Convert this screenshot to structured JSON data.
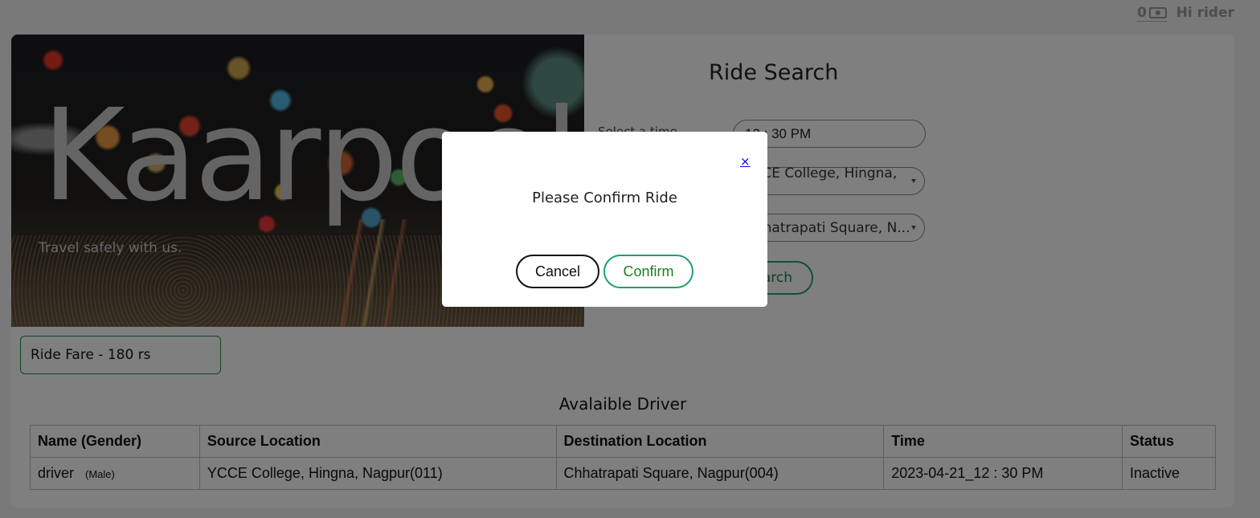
{
  "header": {
    "wallet_amount": "0",
    "wallet_icon": "money-icon",
    "greeting": "Hi rider"
  },
  "hero": {
    "brand": "Kaarpool",
    "tagline": "Travel safely with us."
  },
  "search": {
    "title": "Ride Search",
    "time_label": "Select a time",
    "time_value": "12 : 30 PM",
    "source_value": "YCCE College, Hingna, ...",
    "destination_value": "Chhatrapati Square, N...",
    "search_label": "Search"
  },
  "fare": {
    "text": "Ride Fare - 180 rs"
  },
  "drivers": {
    "title": "Avalaible Driver",
    "columns": [
      "Name (Gender)",
      "Source Location",
      "Destination Location",
      "Time",
      "Status"
    ],
    "rows": [
      {
        "name": "driver",
        "gender": "(Male)",
        "source": "YCCE College, Hingna, Nagpur(011)",
        "destination": "Chhatrapati Square, Nagpur(004)",
        "time": "2023-04-21_12 : 30 PM",
        "status": "Inactive"
      }
    ]
  },
  "modal": {
    "close_label": "×",
    "title": "Please Confirm Ride",
    "cancel_label": "Cancel",
    "confirm_label": "Confirm"
  },
  "colors": {
    "accent_green": "#22a06b",
    "overlay": "rgba(0,0,0,0.5)"
  }
}
